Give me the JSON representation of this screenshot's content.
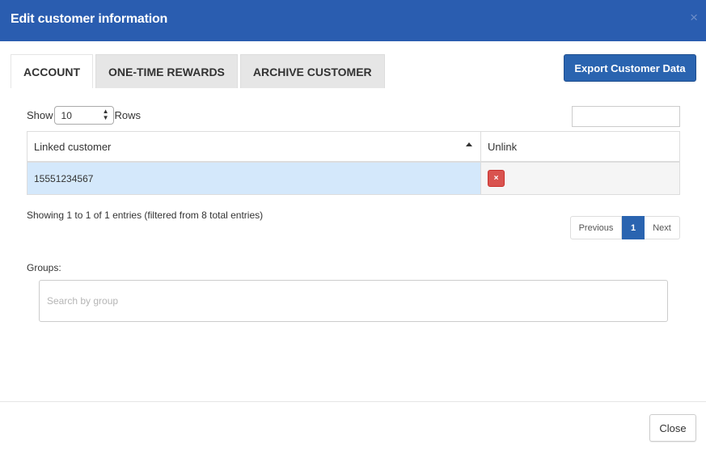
{
  "modal": {
    "title": "Edit customer information",
    "header_close_glyph": "×"
  },
  "tabs": [
    {
      "label": "ACCOUNT",
      "active": true
    },
    {
      "label": "ONE-TIME REWARDS",
      "active": false
    },
    {
      "label": "ARCHIVE CUSTOMER",
      "active": false
    }
  ],
  "export_button": {
    "label": "Export Customer Data"
  },
  "table_controls": {
    "show_label": "Show",
    "rows_value": "10",
    "rows_label": "Rows",
    "search_value": ""
  },
  "table": {
    "columns": [
      "Linked customer",
      "Unlink"
    ],
    "sort_icon": "sort-asc-icon",
    "rows": [
      {
        "linked_customer": "15551234567",
        "unlink_glyph": "×"
      }
    ]
  },
  "info": {
    "text": "Showing 1 to 1 of 1 entries (filtered from 8 total entries)"
  },
  "pagination": {
    "previous": "Previous",
    "current": "1",
    "next": "Next"
  },
  "groups": {
    "label": "Groups:",
    "placeholder": "Search by group"
  },
  "footer": {
    "close_label": "Close"
  },
  "colors": {
    "header_bg": "#2a5db0",
    "primary_button": "#2a64b0",
    "selected_row": "#d4e8fb",
    "danger": "#d9534f"
  }
}
